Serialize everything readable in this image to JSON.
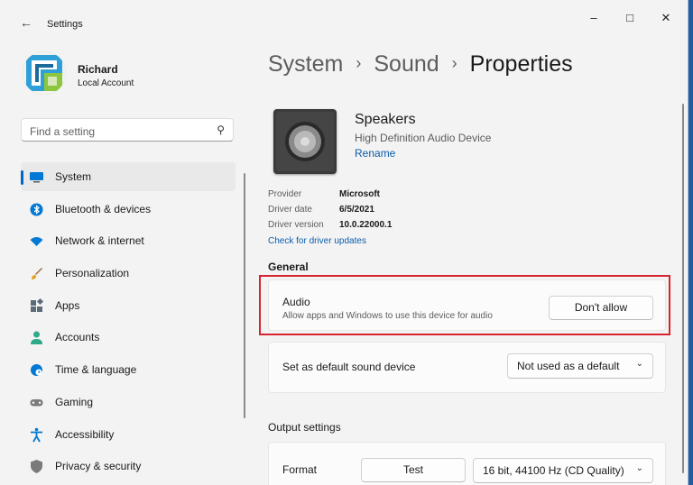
{
  "window": {
    "app_title": "Settings"
  },
  "user": {
    "name": "Richard",
    "account": "Local Account"
  },
  "search": {
    "placeholder": "Find a setting"
  },
  "nav": {
    "items": [
      {
        "label": "System",
        "icon": "monitor-icon",
        "color": "#0078d4"
      },
      {
        "label": "Bluetooth & devices",
        "icon": "bluetooth-icon",
        "color": "#0078d4"
      },
      {
        "label": "Network & internet",
        "icon": "wifi-icon",
        "color": "#0078d4"
      },
      {
        "label": "Personalization",
        "icon": "brush-icon",
        "color": "#e3a21a"
      },
      {
        "label": "Apps",
        "icon": "apps-icon",
        "color": "#5c6b7a"
      },
      {
        "label": "Accounts",
        "icon": "person-icon",
        "color": "#2ea98a"
      },
      {
        "label": "Time & language",
        "icon": "globe-clock-icon",
        "color": "#0078d4"
      },
      {
        "label": "Gaming",
        "icon": "controller-icon",
        "color": "#7a7a7a"
      },
      {
        "label": "Accessibility",
        "icon": "accessibility-icon",
        "color": "#0078d4"
      },
      {
        "label": "Privacy & security",
        "icon": "shield-icon",
        "color": "#7a7a7a"
      }
    ],
    "active_index": 0
  },
  "breadcrumb": {
    "parts": [
      "System",
      "Sound"
    ],
    "current": "Properties"
  },
  "device": {
    "name": "Speakers",
    "description": "High Definition Audio Device",
    "rename_label": "Rename",
    "icon": "speaker-icon"
  },
  "driver_info": {
    "provider_label": "Provider",
    "provider_value": "Microsoft",
    "date_label": "Driver date",
    "date_value": "6/5/2021",
    "version_label": "Driver version",
    "version_value": "10.0.22000.1",
    "check_updates_label": "Check for driver updates"
  },
  "general": {
    "title": "General",
    "audio": {
      "title": "Audio",
      "subtitle": "Allow apps and Windows to use this device for audio",
      "button_label": "Don't allow"
    },
    "default_device": {
      "label": "Set as default sound device",
      "dropdown_value": "Not used as a default"
    }
  },
  "output": {
    "title": "Output settings",
    "format_label": "Format",
    "test_button_label": "Test",
    "format_value": "16 bit, 44100 Hz (CD Quality)"
  },
  "colors": {
    "accent": "#0067c0",
    "highlight": "#d8232f"
  }
}
